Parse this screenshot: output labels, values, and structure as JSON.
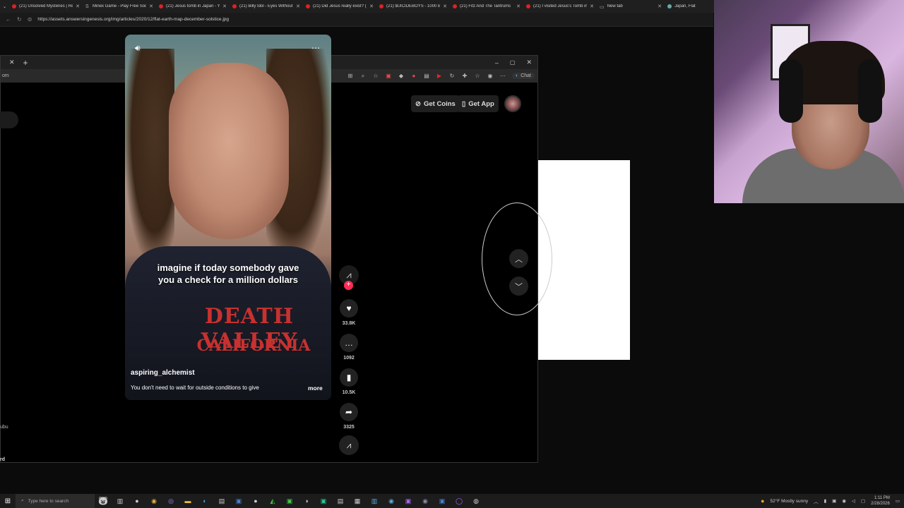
{
  "browser": {
    "tabs": [
      {
        "title": "(21) Unsolved Mysteries | Re",
        "favicon": "yt"
      },
      {
        "title": "Minex Game - Play Free Soc",
        "favicon": "s"
      },
      {
        "title": "(21) Jesus tomb in Japan - Y",
        "favicon": "yt"
      },
      {
        "title": "(21) Billy Idol - Eyes Without",
        "favicon": "yt"
      },
      {
        "title": "(21) Did Jesus really exist? (",
        "favicon": "yt"
      },
      {
        "title": "(21) $UICIDEBOYS - 1000 Bl",
        "favicon": "yt"
      },
      {
        "title": "(21) Fitz And The Tantrums",
        "favicon": "yt"
      },
      {
        "title": "(21) I visited Jesus's Tomb in",
        "favicon": "yt"
      },
      {
        "title": "New tab",
        "favicon": "new"
      },
      {
        "title": "Japan, Flat",
        "favicon": "g"
      }
    ],
    "url": "https://assets.answersingenesis.org/img/articles/2020/12/flat-earth-map-december-solstice.jpg"
  },
  "inner_window": {
    "tab_fragment": "om",
    "chat_label": "Chat"
  },
  "tiktok": {
    "get_coins": "Get Coins",
    "get_app": "Get App",
    "caption": "imagine if today somebody gave you a check for a million dollars",
    "shirt_line1": "DEATH VALLEY",
    "shirt_line2": "CALIFORNIA",
    "author": "aspiring_alchemist",
    "description": "You don't need to wait for outside conditions to give",
    "more": "more",
    "likes": "33.8K",
    "comments": "1092",
    "saves": "10.5K",
    "shares": "3325",
    "accent_color": "#fe2c55"
  },
  "left_fragments": {
    "bottom1": "ubu",
    "bottom2": "rd"
  },
  "taskbar": {
    "search_placeholder": "Type here to search",
    "weather": "52°F  Mostly sunny",
    "time": "1:11 PM",
    "date": "2/28/2026"
  }
}
